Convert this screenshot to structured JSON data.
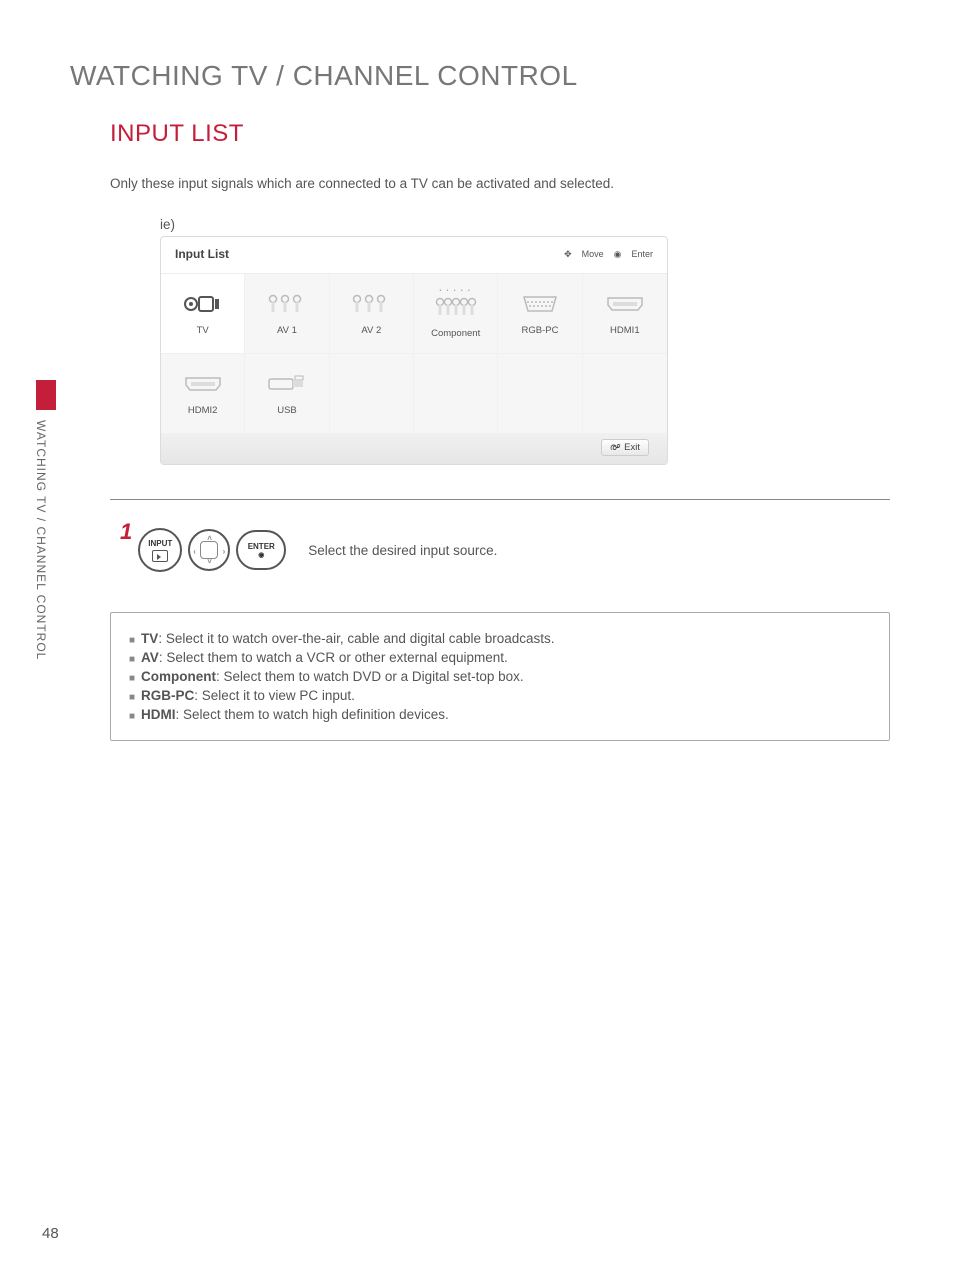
{
  "sideSection": "WATCHING TV / CHANNEL CONTROL",
  "heading1": "WATCHING TV / CHANNEL CONTROL",
  "heading2": "INPUT LIST",
  "intro": "Only these input signals which are connected to a TV can be activated and selected.",
  "ieLabel": "ie)",
  "panel": {
    "title": "Input List",
    "hintMove": "Move",
    "hintEnter": "Enter",
    "exit": "Exit",
    "inputs": [
      {
        "label": "TV",
        "active": true,
        "selected": false,
        "icon": "tv"
      },
      {
        "label": "AV 1",
        "active": false,
        "selected": false,
        "icon": "rca3"
      },
      {
        "label": "AV 2",
        "active": false,
        "selected": false,
        "icon": "rca3"
      },
      {
        "label": "Component",
        "active": false,
        "selected": true,
        "icon": "rca5"
      },
      {
        "label": "RGB-PC",
        "active": false,
        "selected": false,
        "icon": "vga"
      },
      {
        "label": "HDMI1",
        "active": false,
        "selected": false,
        "icon": "hdmi"
      },
      {
        "label": "HDMI2",
        "active": false,
        "selected": false,
        "icon": "hdmi"
      },
      {
        "label": "USB",
        "active": false,
        "selected": false,
        "icon": "usb"
      }
    ]
  },
  "step": {
    "number": "1",
    "inputLabel": "INPUT",
    "enterLabel": "ENTER",
    "text": "Select the desired input source."
  },
  "descriptions": [
    {
      "term": "TV",
      "text": ": Select it to watch over-the-air, cable and digital cable broadcasts."
    },
    {
      "term": "AV",
      "text": ": Select them to watch a VCR or other external equipment."
    },
    {
      "term": "Component",
      "text": ": Select them to watch DVD or a Digital set-top box."
    },
    {
      "term": "RGB-PC",
      "text": ": Select it to view PC input."
    },
    {
      "term": "HDMI",
      "text": ": Select them to watch high definition devices."
    }
  ],
  "pageNumber": "48"
}
